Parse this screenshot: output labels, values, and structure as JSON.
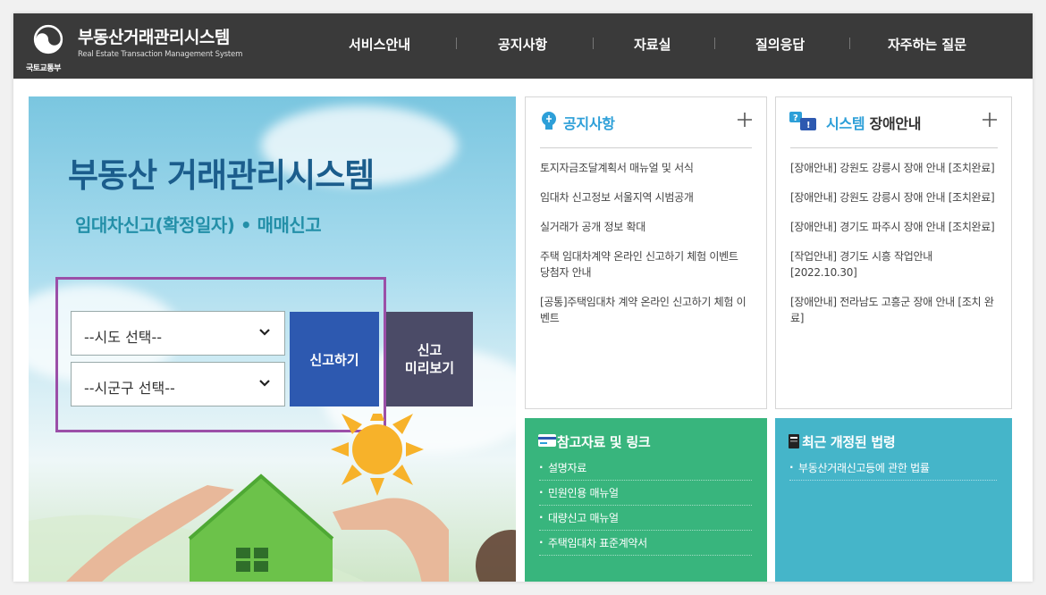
{
  "header": {
    "title": "부동산거래관리시스템",
    "subtitle": "Real Estate Transaction Management System",
    "ministry": "국토교통부",
    "nav": [
      "서비스안내",
      "공지사항",
      "자료실",
      "질의응답",
      "자주하는 질문"
    ]
  },
  "hero": {
    "title": "부동산 거래관리시스템",
    "subtitle": "임대차신고(확정일자) • 매매신고",
    "province_select": "--시도 선택--",
    "district_select": "--시군구 선택--",
    "report_button": "신고하기",
    "preview_button_line1": "신고",
    "preview_button_line2": "미리보기"
  },
  "notice": {
    "title": "공지사항",
    "items": [
      "토지자금조달계획서 매뉴얼 및 서식",
      "임대차 신고정보 서울지역 시범공개",
      "실거래가 공개 정보 확대",
      "주택 임대차계약 온라인 신고하기 체험 이벤트 당첨자 안내",
      "[공통]주택임대차 계약 온라인 신고하기 체험 이벤트"
    ]
  },
  "outage": {
    "title_accent": "시스템",
    "title_rest": "장애안내",
    "items": [
      "[장애안내] 강원도 강릉시 장애 안내 [조치완료]",
      "[장애안내] 강원도 강릉시 장애 안내 [조치완료]",
      "[장애안내] 경기도 파주시 장애 안내 [조치완료]",
      "[작업안내] 경기도 시흥 작업안내 [2022.10.30]",
      "[장애안내] 전라남도 고흥군 장애 안내 [조치 완료]"
    ]
  },
  "references": {
    "title": "참고자료 및 링크",
    "items": [
      "설명자료",
      "민원인용 매뉴얼",
      "대량신고 매뉴얼",
      "주택임대차 표준계약서"
    ]
  },
  "laws": {
    "title": "최근 개정된 법령",
    "items": [
      "부동산거래신고등에 관한 법률"
    ]
  },
  "colors": {
    "header_bg": "#3a3a3a",
    "accent_blue": "#2d9fd8",
    "report_button": "#2d59b0",
    "preview_button": "#4b4b67",
    "references_bg": "#38b57d",
    "laws_bg": "#45b5c9",
    "form_border": "#9b4fa8"
  }
}
